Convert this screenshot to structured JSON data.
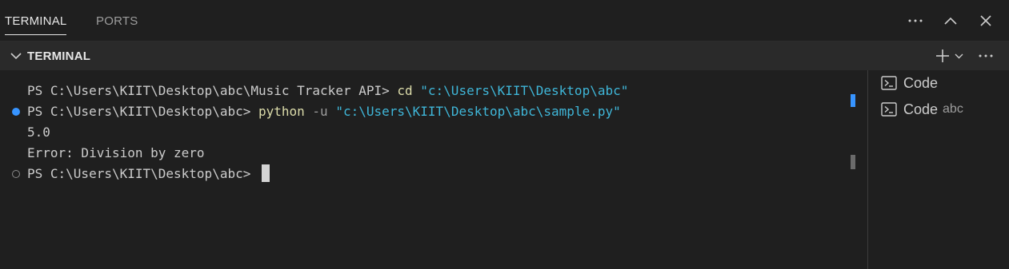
{
  "tabs": [
    {
      "label": "TERMINAL",
      "active": true
    },
    {
      "label": "PORTS",
      "active": false
    }
  ],
  "top_actions": {
    "more_icon": "ellipsis-icon",
    "maximize_icon": "chevron-up-icon",
    "close_icon": "close-icon"
  },
  "section": {
    "title": "TERMINAL",
    "collapse_icon": "chevron-down-icon",
    "add_icon": "plus-icon",
    "add_dropdown_icon": "chevron-down-icon",
    "more_icon": "ellipsis-icon"
  },
  "terminal": {
    "line1": {
      "prompt": "PS C:\\Users\\KIIT\\Desktop\\abc\\Music Tracker API> ",
      "command": "cd",
      "arg": " \"c:\\Users\\KIIT\\Desktop\\abc\""
    },
    "line2": {
      "prompt": "PS C:\\Users\\KIIT\\Desktop\\abc> ",
      "command": "python",
      "flag": " -u",
      "arg": " \"c:\\Users\\KIIT\\Desktop\\abc\\sample.py\""
    },
    "line3": "5.0",
    "line4": "Error: Division by zero",
    "line5": {
      "prompt": "PS C:\\Users\\KIIT\\Desktop\\abc> "
    }
  },
  "terminal_list": [
    {
      "icon": "terminal-icon",
      "label": "Code",
      "sub": ""
    },
    {
      "icon": "terminal-icon",
      "label": "Code",
      "sub": "abc"
    }
  ],
  "colors": {
    "background": "#1f1f1f",
    "header": "#2a2a2a",
    "command": "#dcdcaa",
    "string": "#3fb6d8",
    "success_dot": "#3794ff"
  }
}
